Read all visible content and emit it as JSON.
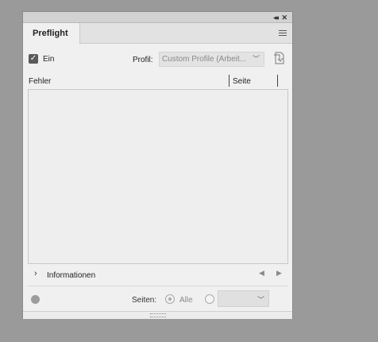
{
  "panel": {
    "collapse_glyph": "◂◂",
    "close_glyph": "✕",
    "tab_label": "Preflight",
    "menu_icon": "hamburger-menu-icon"
  },
  "options": {
    "on_checked": true,
    "on_label": "Ein",
    "profile_label": "Profil:",
    "profile_value": "Custom Profile (Arbeit..."
  },
  "table": {
    "columns": [
      "Fehler",
      "Seite"
    ],
    "rows": []
  },
  "info": {
    "label": "Informationen"
  },
  "footer": {
    "pages_label": "Seiten:",
    "all_label": "Alle",
    "all_selected": true,
    "range_value": ""
  },
  "colors": {
    "background": "#9a9a9a",
    "panel": "#f0f0f0",
    "accent": "#5a5a5a"
  }
}
